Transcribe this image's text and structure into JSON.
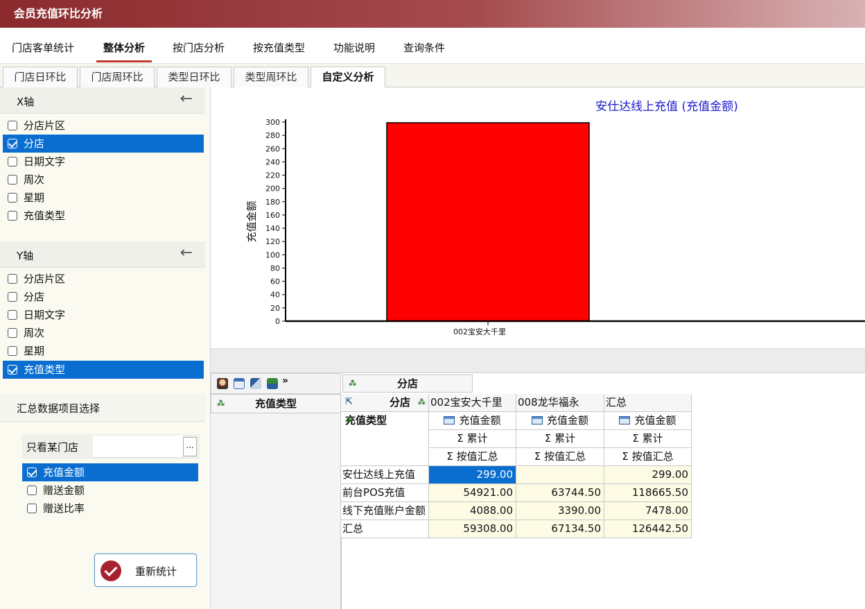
{
  "window": {
    "title": "会员充值环比分析"
  },
  "main_tabs": [
    {
      "label": "门店客单统计"
    },
    {
      "label": "整体分析",
      "active": true
    },
    {
      "label": "按门店分析"
    },
    {
      "label": "按充值类型"
    },
    {
      "label": "功能说明"
    },
    {
      "label": "查询条件"
    }
  ],
  "sub_tabs": [
    {
      "label": "门店日环比"
    },
    {
      "label": "门店周环比"
    },
    {
      "label": "类型日环比"
    },
    {
      "label": "类型周环比"
    },
    {
      "label": "自定义分析",
      "active": true
    }
  ],
  "x_axis": {
    "title": "X轴",
    "back_icon": "arrow-left-icon",
    "options": [
      {
        "label": "分店片区",
        "checked": false
      },
      {
        "label": "分店",
        "checked": true,
        "selected": true
      },
      {
        "label": "日期文字",
        "checked": false
      },
      {
        "label": "周次",
        "checked": false
      },
      {
        "label": "星期",
        "checked": false
      },
      {
        "label": "充值类型",
        "checked": false
      }
    ]
  },
  "y_axis": {
    "title": "Y轴",
    "back_icon": "arrow-left-icon",
    "options": [
      {
        "label": "分店片区",
        "checked": false
      },
      {
        "label": "分店",
        "checked": false
      },
      {
        "label": "日期文字",
        "checked": false
      },
      {
        "label": "周次",
        "checked": false
      },
      {
        "label": "星期",
        "checked": false
      },
      {
        "label": "充值类型",
        "checked": true,
        "selected": true
      }
    ]
  },
  "summary": {
    "title": "汇总数据项目选择",
    "store_filter_label": "只看某门店",
    "store_filter_value": "",
    "browse_label": "...",
    "items": [
      {
        "label": "充值金额",
        "checked": true,
        "selected": true
      },
      {
        "label": "赠送金额",
        "checked": false
      },
      {
        "label": "赠送比率",
        "checked": false
      }
    ],
    "recalc_label": "重新统计"
  },
  "chart_data": {
    "type": "bar",
    "title": "安仕达线上充值 (充值金额)",
    "ylabel": "充值金额",
    "xlabel": "",
    "categories": [
      "002宝安大千里"
    ],
    "values": [
      299
    ],
    "ylim": [
      0,
      300
    ],
    "yticks": [
      0,
      20,
      40,
      60,
      80,
      100,
      120,
      140,
      160,
      180,
      200,
      220,
      240,
      260,
      280,
      300
    ],
    "bar_color": "#ff0000",
    "title_color": "#1a1acc",
    "grid": false,
    "legend": "none"
  },
  "pivot": {
    "column_field": "分店",
    "row_field_header": "充值类型",
    "row_field_label": "充值类型",
    "corner_label": "分店",
    "columns": [
      "002宝安大千里",
      "008龙华福永",
      "汇总"
    ],
    "measure_label": "充值金额",
    "agg_label": "Σ 累计",
    "summary_label": "Σ 按值汇总",
    "rows": [
      {
        "label": "安仕达线上充值",
        "values": [
          "299.00",
          "",
          "299.00"
        ]
      },
      {
        "label": "前台POS充值",
        "values": [
          "54921.00",
          "63744.50",
          "118665.50"
        ]
      },
      {
        "label": "线下充值账户金额",
        "values": [
          "4088.00",
          "3390.00",
          "7478.00"
        ]
      },
      {
        "label": "汇总",
        "values": [
          "59308.00",
          "67134.50",
          "126442.50"
        ]
      }
    ]
  }
}
